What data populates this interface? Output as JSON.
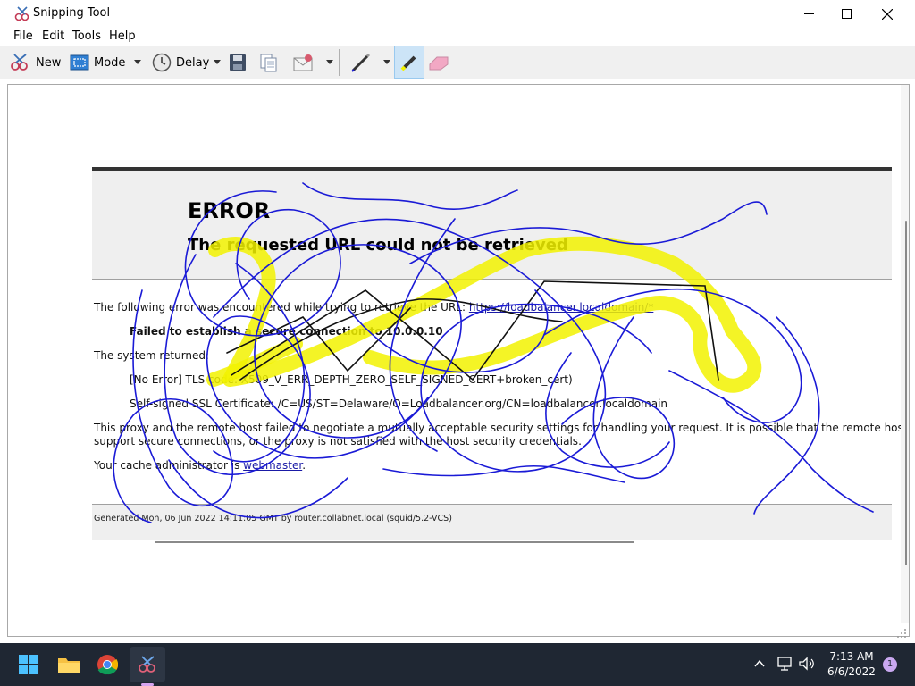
{
  "window": {
    "title": "Snipping Tool",
    "controls": {
      "minimize": "minimize",
      "maximize": "maximize",
      "close": "close"
    }
  },
  "menu": [
    "File",
    "Edit",
    "Tools",
    "Help"
  ],
  "toolbar": {
    "new_label": "New",
    "mode_label": "Mode",
    "delay_label": "Delay",
    "icons": [
      "new-snip-icon",
      "mode-icon",
      "delay-clock-icon",
      "save-icon",
      "copy-icon",
      "send-email-icon",
      "pen-icon",
      "highlighter-icon",
      "eraser-icon"
    ]
  },
  "snip": {
    "error_title": "ERROR",
    "error_subtitle": "The requested URL could not be retrieved",
    "line1_prefix": "The following error was encountered while trying to retrieve the URL: ",
    "line1_link": "https://loadbalancer.localdomain/*",
    "failed": "Failed to establish a secure connection to 10.0.0.10",
    "system_returned": "The system returned:",
    "code_line": "[No Error] TLS code: X509_V_ERR_DEPTH_ZERO_SELF_SIGNED_CERT+broken_cert)",
    "cert_line": "Self-signed SSL Certificate: /C=US/ST=Delaware/O=Loadbalancer.org/CN=loadbalancer.localdomain",
    "proxy_line1": "This proxy and the remote host failed to negotiate a mutually acceptable security settings for handling your request. It is possible that the remote host does not",
    "proxy_line2": "support secure connections, or the proxy is not satisfied with the host security credentials.",
    "admin_prefix": "Your cache administrator is ",
    "admin_link": "webmaster",
    "admin_suffix": ".",
    "footer": "Generated Mon, 06 Jun 2022 14:11:05 GMT by router.collabnet.local (squid/5.2-VCS)"
  },
  "annotations": {
    "pen_color": "#1a1ad6",
    "highlighter_color": "#f2f200",
    "ink_color": "#111111"
  },
  "taskbar": {
    "apps": [
      "windows-start-icon",
      "file-explorer-icon",
      "chrome-icon",
      "snipping-tool-icon"
    ],
    "tray_icons": [
      "chevron-up-icon",
      "network-icon",
      "volume-icon"
    ],
    "time": "7:13 AM",
    "date": "6/6/2022",
    "notifications": "1"
  },
  "colors": {
    "taskbar_bg": "#1f2733",
    "toolbar_bg": "#f0f0f0",
    "active_tool": "#cce4f7"
  }
}
